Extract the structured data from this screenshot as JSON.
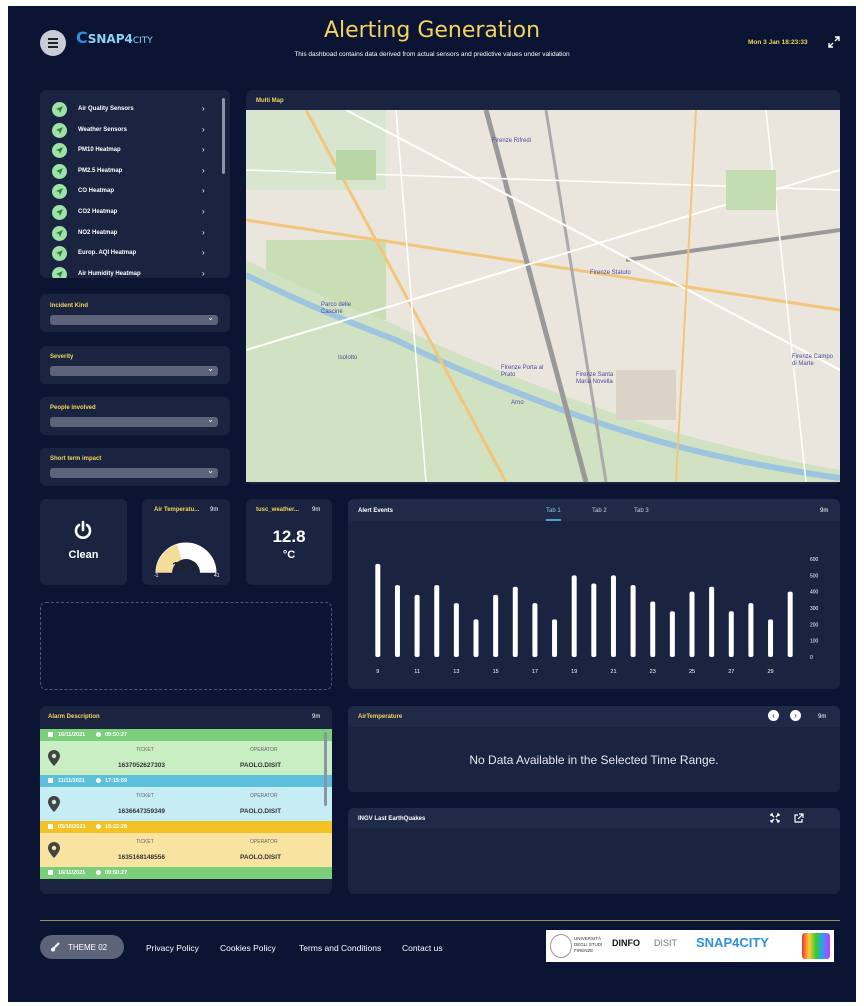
{
  "header": {
    "title": "Alerting Generation",
    "subtitle": "This dashboad contains data derived from actual sensors and predictive values under validation",
    "datetime": "Mon 3 Jan 18:23:33",
    "logo_prefix": "SNAP4",
    "logo_suffix": "CITY"
  },
  "layers": [
    {
      "label": "Air Quality Sensors"
    },
    {
      "label": "Weather Sensors"
    },
    {
      "label": "PM10 Heatmap"
    },
    {
      "label": "PM2.5 Heatmap"
    },
    {
      "label": "CO Heatmap"
    },
    {
      "label": "CO2 Heatmap"
    },
    {
      "label": "NO2 Heatmap"
    },
    {
      "label": "Europ. AQI Heatmap"
    },
    {
      "label": "Air Humidity Heatmap"
    }
  ],
  "filters": {
    "incident_kind": "Incident Kind",
    "severity": "Severity",
    "people_involved": "People involved",
    "short_term_impact": "Short term impact"
  },
  "map": {
    "title": "Multi Map",
    "labels": [
      "Firenze Rifredi",
      "Firenze Statuto",
      "Parco delle Cascine",
      "Isolotto",
      "Firenze Porta al Prato",
      "Firenze Santa Maria Novella",
      "Firenze Campo di Marte",
      "Arno"
    ]
  },
  "status_widget": {
    "label": "Clean"
  },
  "gauge": {
    "title": "Air Temperatu...",
    "age": "9m",
    "value": "15.9",
    "min": "-1",
    "max": "41"
  },
  "weather_widget": {
    "title": "tusc_weather...",
    "age": "9m",
    "value": "12.8",
    "unit": "°C"
  },
  "alert_events": {
    "title": "Alert Events",
    "age": "9m",
    "tabs": [
      "Tab 1",
      "Tab 2",
      "Tab 3"
    ],
    "active_tab": "Tab 1"
  },
  "chart_data": {
    "type": "bar",
    "title": "",
    "x": [
      9,
      10,
      11,
      12,
      13,
      14,
      15,
      16,
      17,
      18,
      19,
      20,
      21,
      22,
      23,
      24,
      25,
      26,
      27,
      28,
      29
    ],
    "x_ticks": [
      "9",
      "11",
      "13",
      "15",
      "17",
      "19",
      "21",
      "23",
      "25",
      "27",
      "29"
    ],
    "y_ticks": [
      "0",
      "100",
      "200",
      "300",
      "400",
      "500",
      "600"
    ],
    "values": [
      570,
      440,
      380,
      440,
      330,
      230,
      380,
      430,
      330,
      230,
      500,
      450,
      500,
      440,
      340,
      280,
      400,
      430,
      280,
      330,
      230,
      400
    ],
    "ylim": [
      0,
      600
    ],
    "color": "#ffffff"
  },
  "alarm": {
    "title": "Alarm Description",
    "age": "9m",
    "ticket_label": "TICKET",
    "operator_label": "OPERATOR",
    "entries": [
      {
        "date": "16/11/2021",
        "time": "09:50:27",
        "ticket": "1637052627303",
        "operator": "PAOLO.DISIT",
        "color": "#7ccf7a",
        "body": "#c9eec3"
      },
      {
        "date": "11/11/2021",
        "time": "17:15:59",
        "ticket": "1636647359349",
        "operator": "PAOLO.DISIT",
        "color": "#5cc0dc",
        "body": "#c6ecf4"
      },
      {
        "date": "05/10/2021",
        "time": "15:22:28",
        "ticket": "1635168148556",
        "operator": "PAOLO.DISIT",
        "color": "#f3c224",
        "body": "#f8e3a0"
      },
      {
        "date": "16/11/2021",
        "time": "09:50:27",
        "ticket": "",
        "operator": "",
        "color": "#7ccf7a",
        "body": "#c9eec3"
      }
    ]
  },
  "air_temperature": {
    "title": "AirTemperature",
    "age": "9m",
    "message": "No Data Available in the Selected Time Range."
  },
  "earthquakes": {
    "title": "INGV Last EarthQuakes"
  },
  "footer": {
    "theme_label": "THEME 02",
    "links": [
      "Privacy Policy",
      "Cookies Policy",
      "Terms and Conditions",
      "Contact us"
    ],
    "partner_logos": [
      "UNIVERSITÀ DEGLI STUDI FIRENZE",
      "DINFO",
      "DISIT",
      "SNAP4CITY"
    ]
  }
}
